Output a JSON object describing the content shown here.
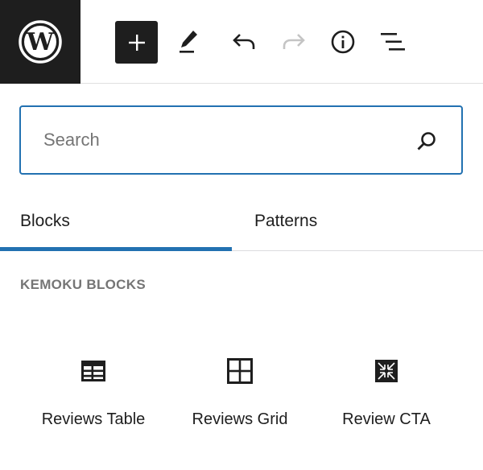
{
  "toolbar": {
    "logo_icon": "wordpress-logo-icon",
    "buttons": [
      {
        "name": "add-block-button",
        "icon": "plus-icon"
      },
      {
        "name": "edit-tools-button",
        "icon": "pencil-icon"
      },
      {
        "name": "undo-button",
        "icon": "undo-icon"
      },
      {
        "name": "redo-button",
        "icon": "redo-icon",
        "disabled": true
      },
      {
        "name": "details-button",
        "icon": "info-icon"
      },
      {
        "name": "list-view-button",
        "icon": "list-view-icon"
      }
    ]
  },
  "inserter": {
    "search": {
      "placeholder": "Search",
      "value": "",
      "icon": "search-icon"
    },
    "tabs": [
      {
        "label": "Blocks",
        "active": true
      },
      {
        "label": "Patterns",
        "active": false
      }
    ],
    "category_title": "KEMOKU BLOCKS",
    "blocks": [
      {
        "label": "Reviews Table",
        "icon": "table-icon"
      },
      {
        "label": "Reviews Grid",
        "icon": "grid-icon"
      },
      {
        "label": "Review CTA",
        "icon": "cta-icon"
      }
    ]
  },
  "colors": {
    "accent": "#2271b1",
    "dark": "#1e1e1e",
    "muted": "#757575",
    "disabled": "#c4c4c4"
  }
}
